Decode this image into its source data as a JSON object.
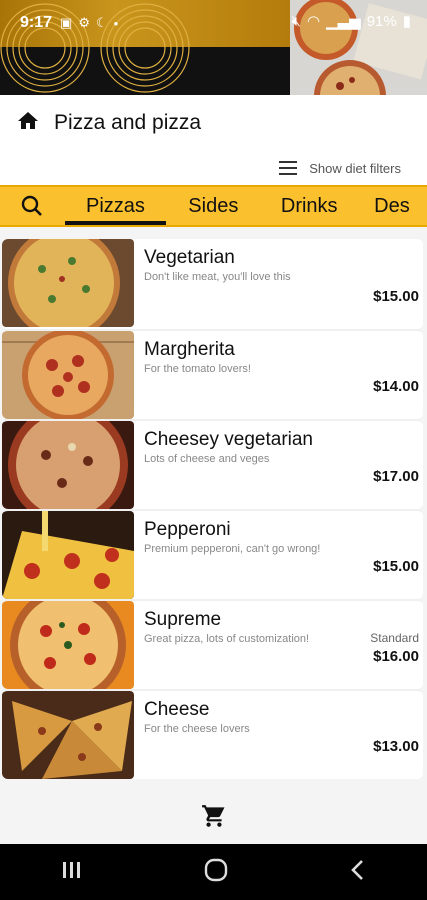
{
  "status_bar": {
    "time": "9:17",
    "battery": "91%"
  },
  "app_bar": {
    "title": "Pizza and pizza"
  },
  "filters": {
    "label": "Show diet filters"
  },
  "tabs": [
    {
      "label": "Pizzas",
      "active": true
    },
    {
      "label": "Sides",
      "active": false
    },
    {
      "label": "Drinks",
      "active": false
    },
    {
      "label": "Des",
      "active": false
    }
  ],
  "menu_items": [
    {
      "name": "Vegetarian",
      "description": "Don't like meat, you'll love this",
      "price": "$15.00",
      "size": ""
    },
    {
      "name": "Margherita",
      "description": "For the tomato lovers!",
      "price": "$14.00",
      "size": ""
    },
    {
      "name": "Cheesey vegetarian",
      "description": "Lots of cheese and veges",
      "price": "$17.00",
      "size": ""
    },
    {
      "name": "Pepperoni",
      "description": "Premium pepperoni, can't go wrong!",
      "price": "$15.00",
      "size": ""
    },
    {
      "name": "Supreme",
      "description": "Great pizza, lots of customization!",
      "price": "$16.00",
      "size": "Standard"
    },
    {
      "name": "Cheese",
      "description": "For the cheese lovers",
      "price": "$13.00",
      "size": ""
    }
  ],
  "colors": {
    "accent": "#fbc02d",
    "banner_gold": "#b8860b",
    "navbar": "#000000"
  }
}
